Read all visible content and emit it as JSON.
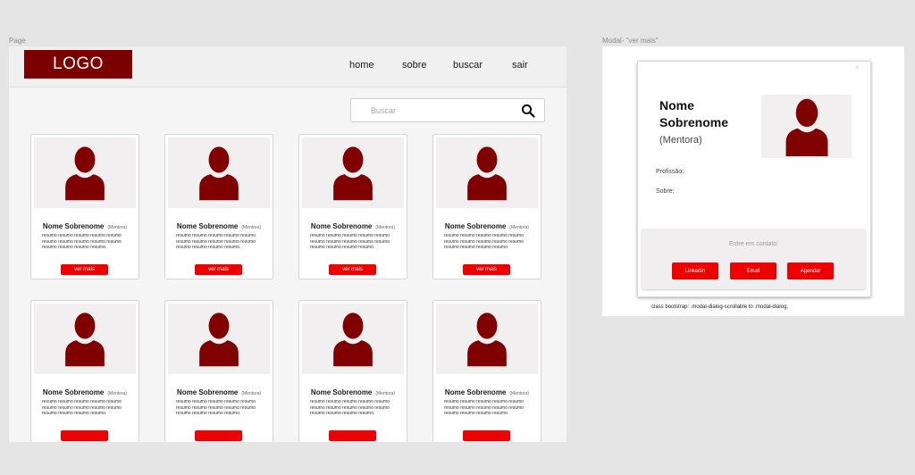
{
  "frames": {
    "page_label": "Page",
    "modal_label": "Modal- \"ver mais\""
  },
  "navbar": {
    "logo": "LOGO",
    "links": [
      "home",
      "sobre",
      "buscar",
      "sair"
    ]
  },
  "search": {
    "placeholder": "Buscar",
    "value": "",
    "icon": "search-icon"
  },
  "cards": [
    {
      "name": "Nome Sobrenome",
      "role": "(Mentora)",
      "summary": "resumo resumo  resumo resumo resumo resumo resumo resumo resumo resumo resumo resumo resumo  resumo.",
      "button": "ver mais"
    },
    {
      "name": "Nome Sobrenome",
      "role": "(Mentora)",
      "summary": "resumo resumo  resumo resumo resumo resumo resumo resumo resumo resumo resumo resumo resumo  resumo.",
      "button": "ver mais"
    },
    {
      "name": "Nome Sobrenome",
      "role": "(Mentora)",
      "summary": "resumo resumo  resumo resumo resumo resumo resumo resumo resumo resumo resumo resumo resumo  resumo.",
      "button": "ver mais"
    },
    {
      "name": "Nome Sobrenome",
      "role": "(Mentora)",
      "summary": "resumo resumo  resumo resumo resumo resumo resumo resumo resumo resumo resumo resumo resumo  resumo.",
      "button": "ver mais"
    },
    {
      "name": "Nome Sobrenome",
      "role": "(Mentora)",
      "summary": "resumo resumo  resumo resumo resumo resumo resumo resumo resumo resumo resumo resumo resumo  resumo.",
      "button": ""
    },
    {
      "name": "Nome Sobrenome",
      "role": "(Mentora)",
      "summary": "resumo resumo  resumo resumo resumo resumo resumo resumo resumo resumo resumo resumo resumo  resumo.",
      "button": ""
    },
    {
      "name": "Nome Sobrenome",
      "role": "(Mentora)",
      "summary": "resumo resumo  resumo resumo resumo resumo resumo resumo resumo resumo resumo resumo resumo  resumo.",
      "button": ""
    },
    {
      "name": "Nome Sobrenome",
      "role": "(Mentora)",
      "summary": "resumo resumo  resumo resumo resumo resumo resumo resumo resumo resumo resumo resumo resumo  resumo.",
      "button": ""
    }
  ],
  "modal": {
    "close": "×",
    "name": "Nome Sobrenome",
    "role": "(Mentora)",
    "profession_label": "Profissão:",
    "about_label": "Sobre:",
    "contact_title": "Entre em contato:",
    "buttons": [
      "Linkedin",
      "Email",
      "Agendar"
    ]
  },
  "note": "class bootstrap: .modal-dialog-scrollable to .modal-dialog.",
  "colors": {
    "brand": "#7b0000",
    "accent": "#ef0000",
    "avatar": "#800000"
  }
}
